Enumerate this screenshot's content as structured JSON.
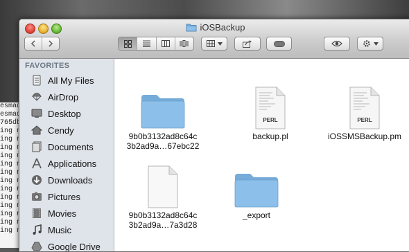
{
  "window": {
    "title": "iOSBackup"
  },
  "sidebar": {
    "header": "FAVORITES",
    "items": [
      {
        "label": "All My Files",
        "icon": "all-files-icon"
      },
      {
        "label": "AirDrop",
        "icon": "airdrop-icon"
      },
      {
        "label": "Desktop",
        "icon": "desktop-icon"
      },
      {
        "label": "Cendy",
        "icon": "home-icon"
      },
      {
        "label": "Documents",
        "icon": "documents-icon"
      },
      {
        "label": "Applications",
        "icon": "applications-icon"
      },
      {
        "label": "Downloads",
        "icon": "downloads-icon"
      },
      {
        "label": "Pictures",
        "icon": "pictures-icon"
      },
      {
        "label": "Movies",
        "icon": "movies-icon"
      },
      {
        "label": "Music",
        "icon": "music-icon"
      },
      {
        "label": "Google Drive",
        "icon": "google-drive-icon"
      }
    ]
  },
  "files": [
    {
      "line1": "9b0b3132ad8c64c",
      "line2": "3b2ad9a…67ebc22",
      "kind": "folder"
    },
    {
      "line1": "backup.pl",
      "line2": "",
      "kind": "perl",
      "badge": "PERL"
    },
    {
      "line1": "iOSSMSBackup.pm",
      "line2": "",
      "kind": "perl",
      "badge": "PERL"
    },
    {
      "line1": "9b0b3132ad8c64c",
      "line2": "3b2ad9a…7a3d28",
      "kind": "document"
    },
    {
      "line1": "_export",
      "line2": "",
      "kind": "folder"
    }
  ],
  "terminal": {
    "lines": [
      "esmad",
      "esmad",
      "765db",
      "ing n",
      "ing n",
      "ing n",
      "ing n",
      "ing n",
      "ing n",
      "ing n",
      "ing n",
      "ing n",
      "ing n",
      "ing n",
      "ing n",
      "ing n"
    ]
  }
}
